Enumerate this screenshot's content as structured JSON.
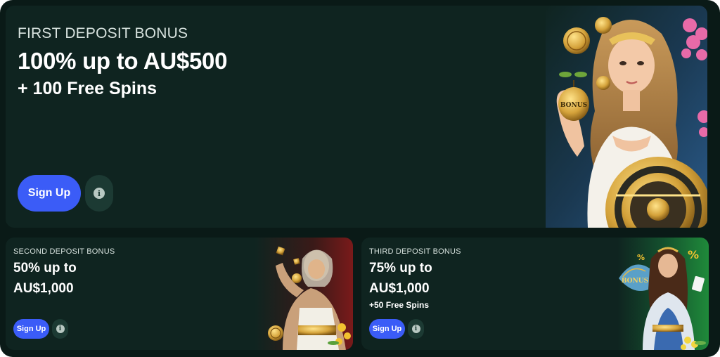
{
  "hero": {
    "eyebrow": "FIRST DEPOSIT BONUS",
    "headline": "100% up to AU$500",
    "sub": "+ 100 Free Spins",
    "signup_label": "Sign Up",
    "info_glyph": "i",
    "art_text": "BONUS",
    "accent": "#3b5cf7"
  },
  "second": {
    "eyebrow": "SECOND DEPOSIT BONUS",
    "line1": "50% up to",
    "line2": "AU$1,000",
    "signup_label": "Sign Up",
    "info_glyph": "i"
  },
  "third": {
    "eyebrow": "THIRD DEPOSIT BONUS",
    "line1": "75% up to",
    "line2": "AU$1,000",
    "extra": "+50 Free Spins",
    "signup_label": "Sign Up",
    "info_glyph": "i",
    "art_text": "BONUS",
    "percent_glyph": "%"
  },
  "colors": {
    "background": "#0a1a17",
    "card": "#0f2420",
    "button_primary": "#3b5cf7",
    "button_info": "#1c3a33"
  }
}
